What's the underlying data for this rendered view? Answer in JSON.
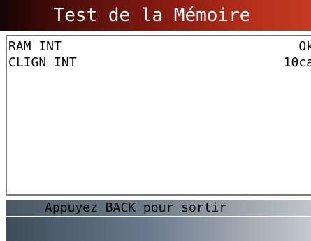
{
  "screen": {
    "title": "Test de la Mémoire",
    "results": [
      {
        "label": "RAM INT",
        "value": "Ok"
      },
      {
        "label": "CLIGN INT",
        "value": "10ca"
      }
    ],
    "footer_hint": "Appuyez BACK pour sortir"
  },
  "colors": {
    "title_bar": "#8a1c12",
    "footer_bar": "#6e7b88",
    "frame_border": "#7b7b7b",
    "text": "#000000"
  }
}
